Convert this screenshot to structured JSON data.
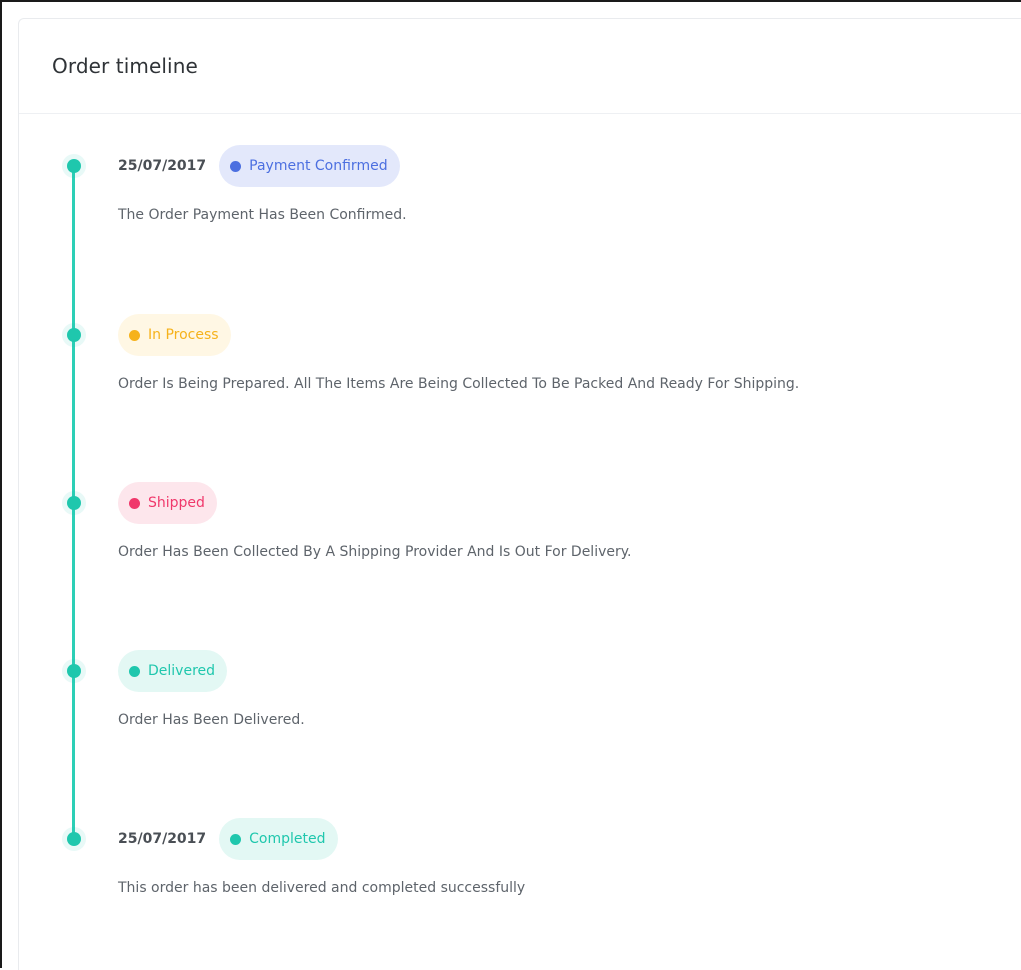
{
  "card": {
    "title": "Order timeline"
  },
  "timeline": {
    "line_color": "#2ccfb6",
    "dot_color": "#1fc7ad",
    "events": [
      {
        "date": "25/07/2017",
        "status": "Payment Confirmed",
        "status_color": "#4c6fe0",
        "badge_bg": "#e3e8fb",
        "description": "The Order Payment Has Been Confirmed."
      },
      {
        "date": "",
        "status": "In Process",
        "status_color": "#f6b21b",
        "badge_bg": "#fff7e4",
        "description": "Order Is Being Prepared. All The Items Are Being Collected To Be Packed And Ready For Shipping."
      },
      {
        "date": "",
        "status": "Shipped",
        "status_color": "#f0386b",
        "badge_bg": "#fde6ec",
        "description": "Order Has Been Collected By A Shipping Provider And Is Out For Delivery."
      },
      {
        "date": "",
        "status": "Delivered",
        "status_color": "#1fc7ad",
        "badge_bg": "#e3f8f4",
        "description": "Order Has Been Delivered."
      },
      {
        "date": "25/07/2017",
        "status": "Completed",
        "status_color": "#1fc7ad",
        "badge_bg": "#e3f8f4",
        "description": "This order has been delivered and completed successfully"
      }
    ]
  }
}
